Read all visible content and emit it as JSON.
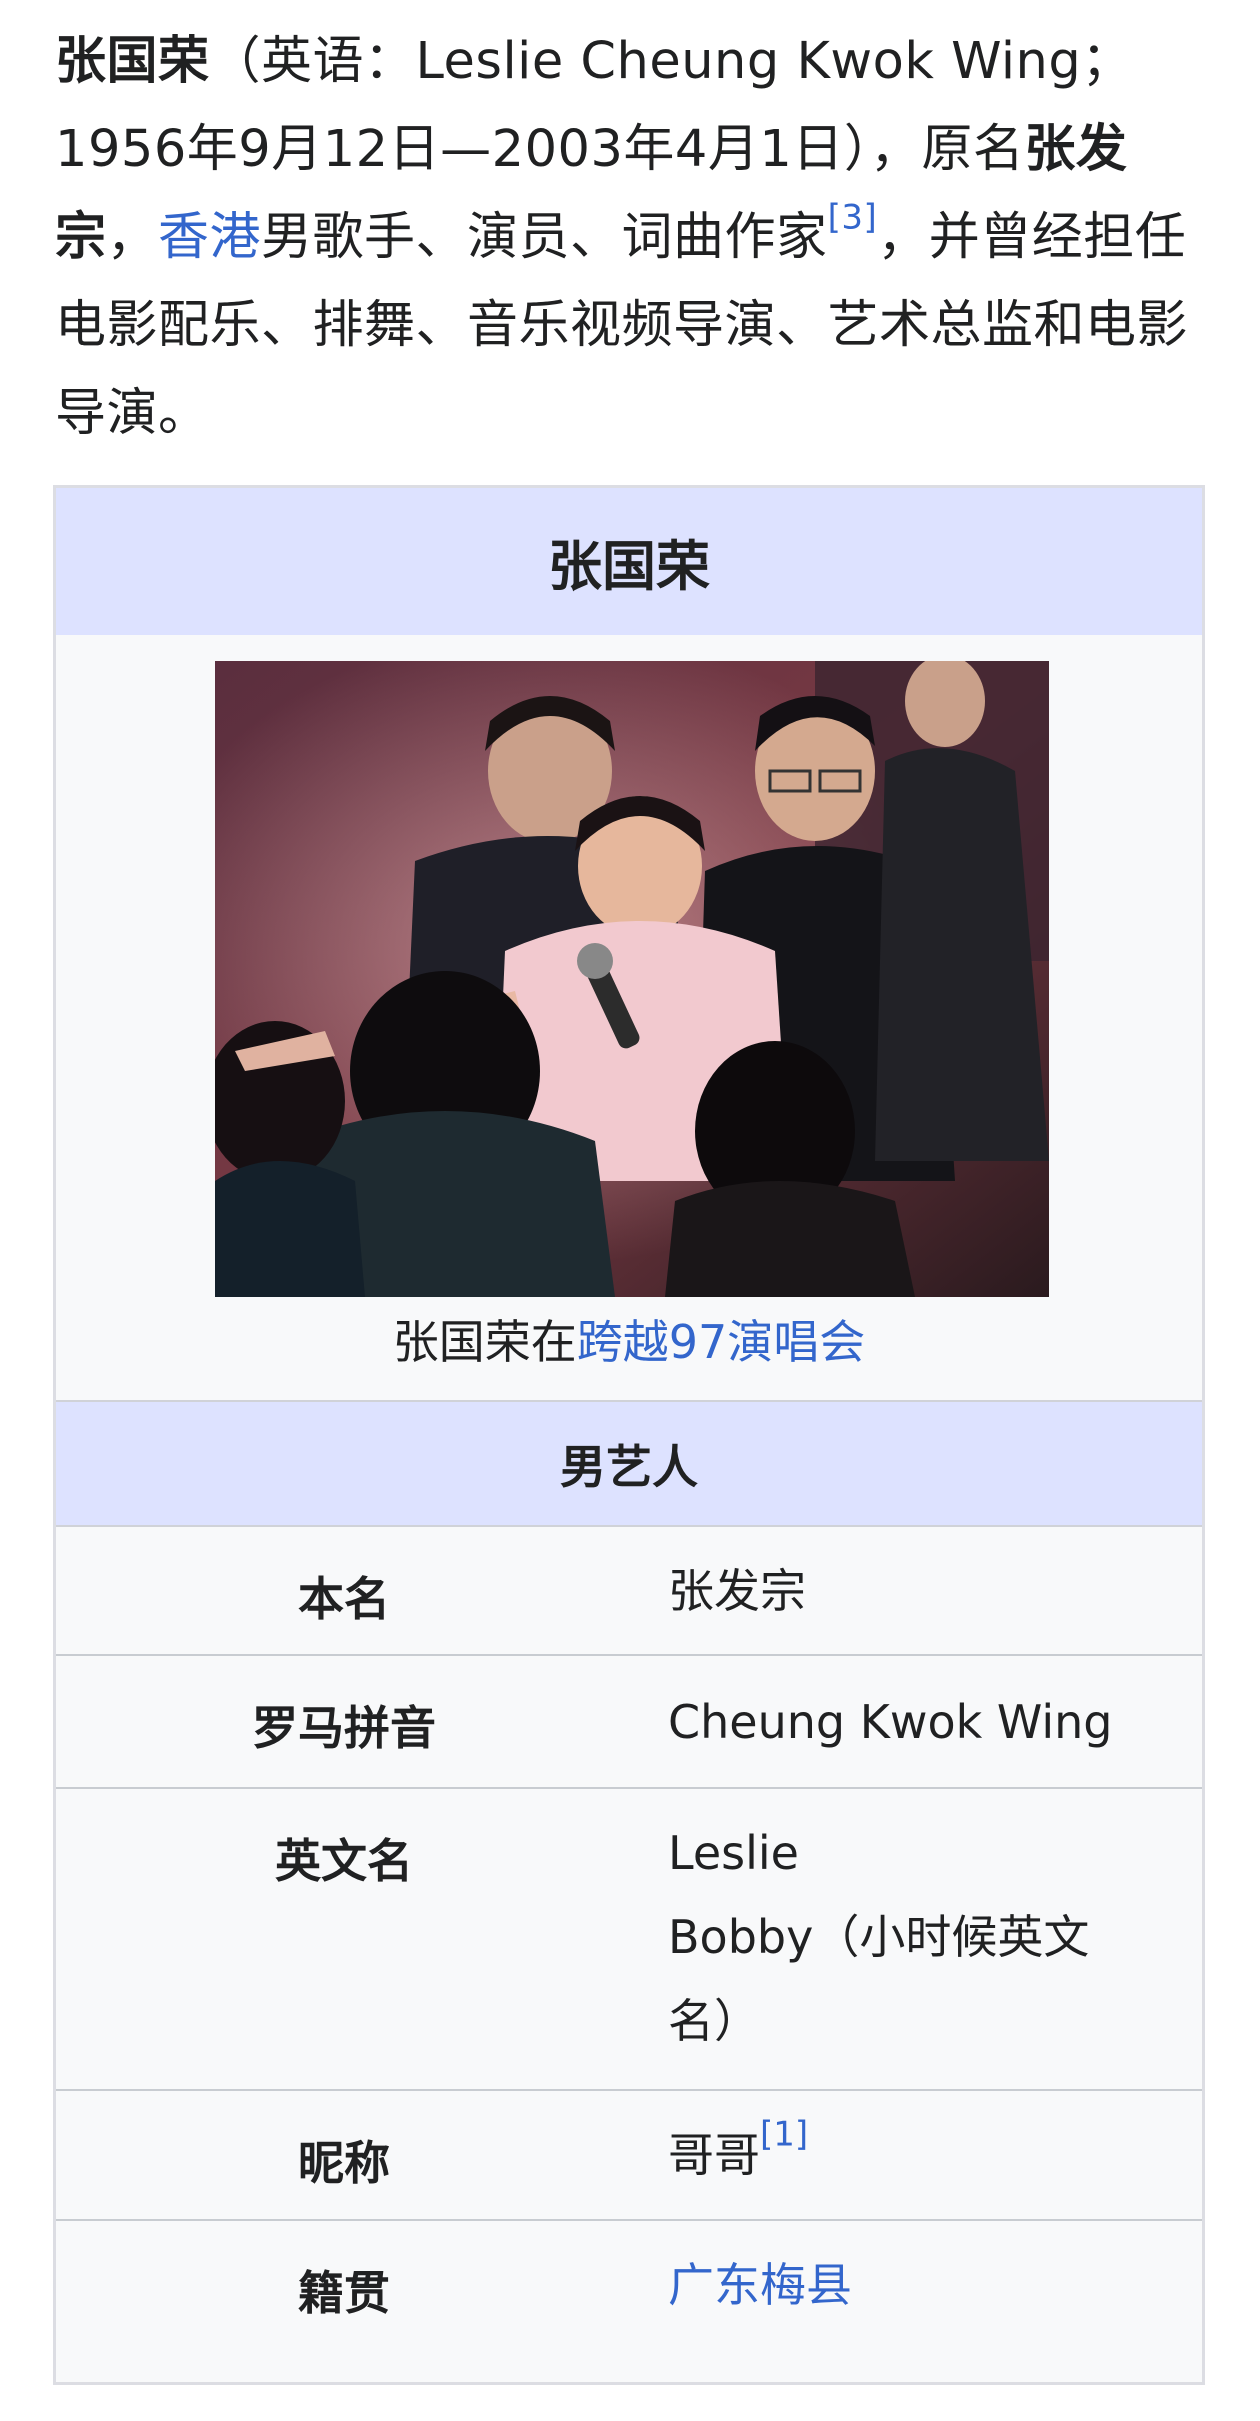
{
  "intro": {
    "name_bold": "张国荣",
    "paren_open": "（英语：",
    "english_name": "Leslie Cheung Kwok Wing",
    "semicolon": "；",
    "dates": "1956年9月12日—2003年4月1日）",
    "orig_name_prefix": "，原名",
    "orig_name_bold": "张发宗",
    "comma": "，",
    "link_hk": "香港",
    "roles": "男歌手、演员、词曲作家",
    "ref_3": "[3]",
    "rest": "，并曾经担任电影配乐、排舞、音乐视频导演、艺术总监和电影导演。"
  },
  "infobox": {
    "title": "张国荣",
    "caption_prefix": "张国荣在",
    "caption_link": "跨越97演唱会",
    "section": "男艺人",
    "rows": [
      {
        "label": "本名",
        "value": "张发宗"
      },
      {
        "label": "罗马拼音",
        "value": "Cheung Kwok Wing"
      },
      {
        "label": "英文名",
        "value_line1": "Leslie",
        "value_line2": "Bobby（小时候英文名）"
      },
      {
        "label": "昵称",
        "value": "哥哥",
        "ref": "[1]"
      },
      {
        "label": "籍贯",
        "value_link": "广东梅县"
      }
    ]
  }
}
